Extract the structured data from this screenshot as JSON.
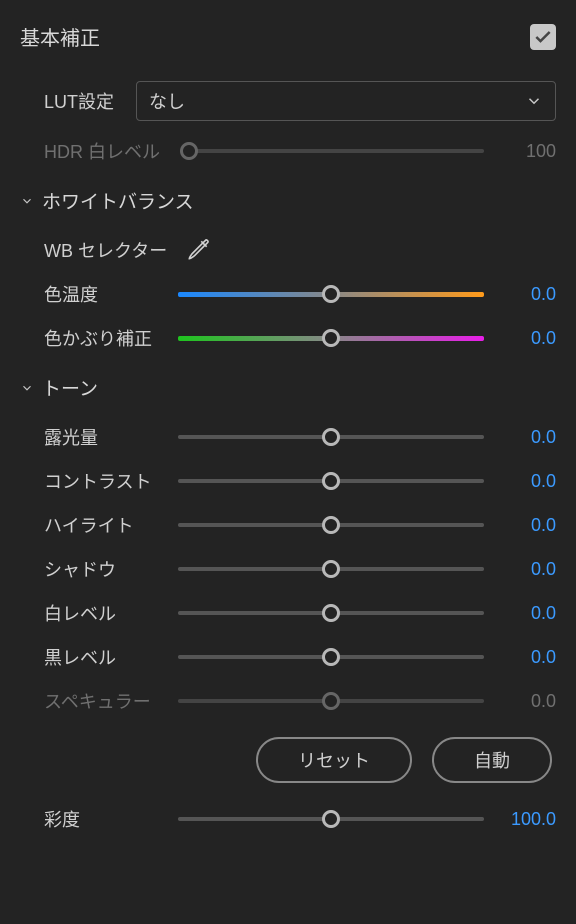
{
  "panel": {
    "title": "基本補正"
  },
  "lut": {
    "label": "LUT設定",
    "selected": "なし"
  },
  "hdr": {
    "label": "HDR 白レベル",
    "value": "100"
  },
  "wb": {
    "section": "ホワイトバランス",
    "selector": "WB セレクター",
    "temp": {
      "label": "色温度",
      "value": "0.0"
    },
    "tint": {
      "label": "色かぶり補正",
      "value": "0.0"
    }
  },
  "tone": {
    "section": "トーン",
    "exposure": {
      "label": "露光量",
      "value": "0.0"
    },
    "contrast": {
      "label": "コントラスト",
      "value": "0.0"
    },
    "highlights": {
      "label": "ハイライト",
      "value": "0.0"
    },
    "shadows": {
      "label": "シャドウ",
      "value": "0.0"
    },
    "whites": {
      "label": "白レベル",
      "value": "0.0"
    },
    "blacks": {
      "label": "黒レベル",
      "value": "0.0"
    },
    "specular": {
      "label": "スペキュラー",
      "value": "0.0"
    },
    "reset": "リセット",
    "auto": "自動"
  },
  "saturation": {
    "label": "彩度",
    "value": "100.0"
  }
}
